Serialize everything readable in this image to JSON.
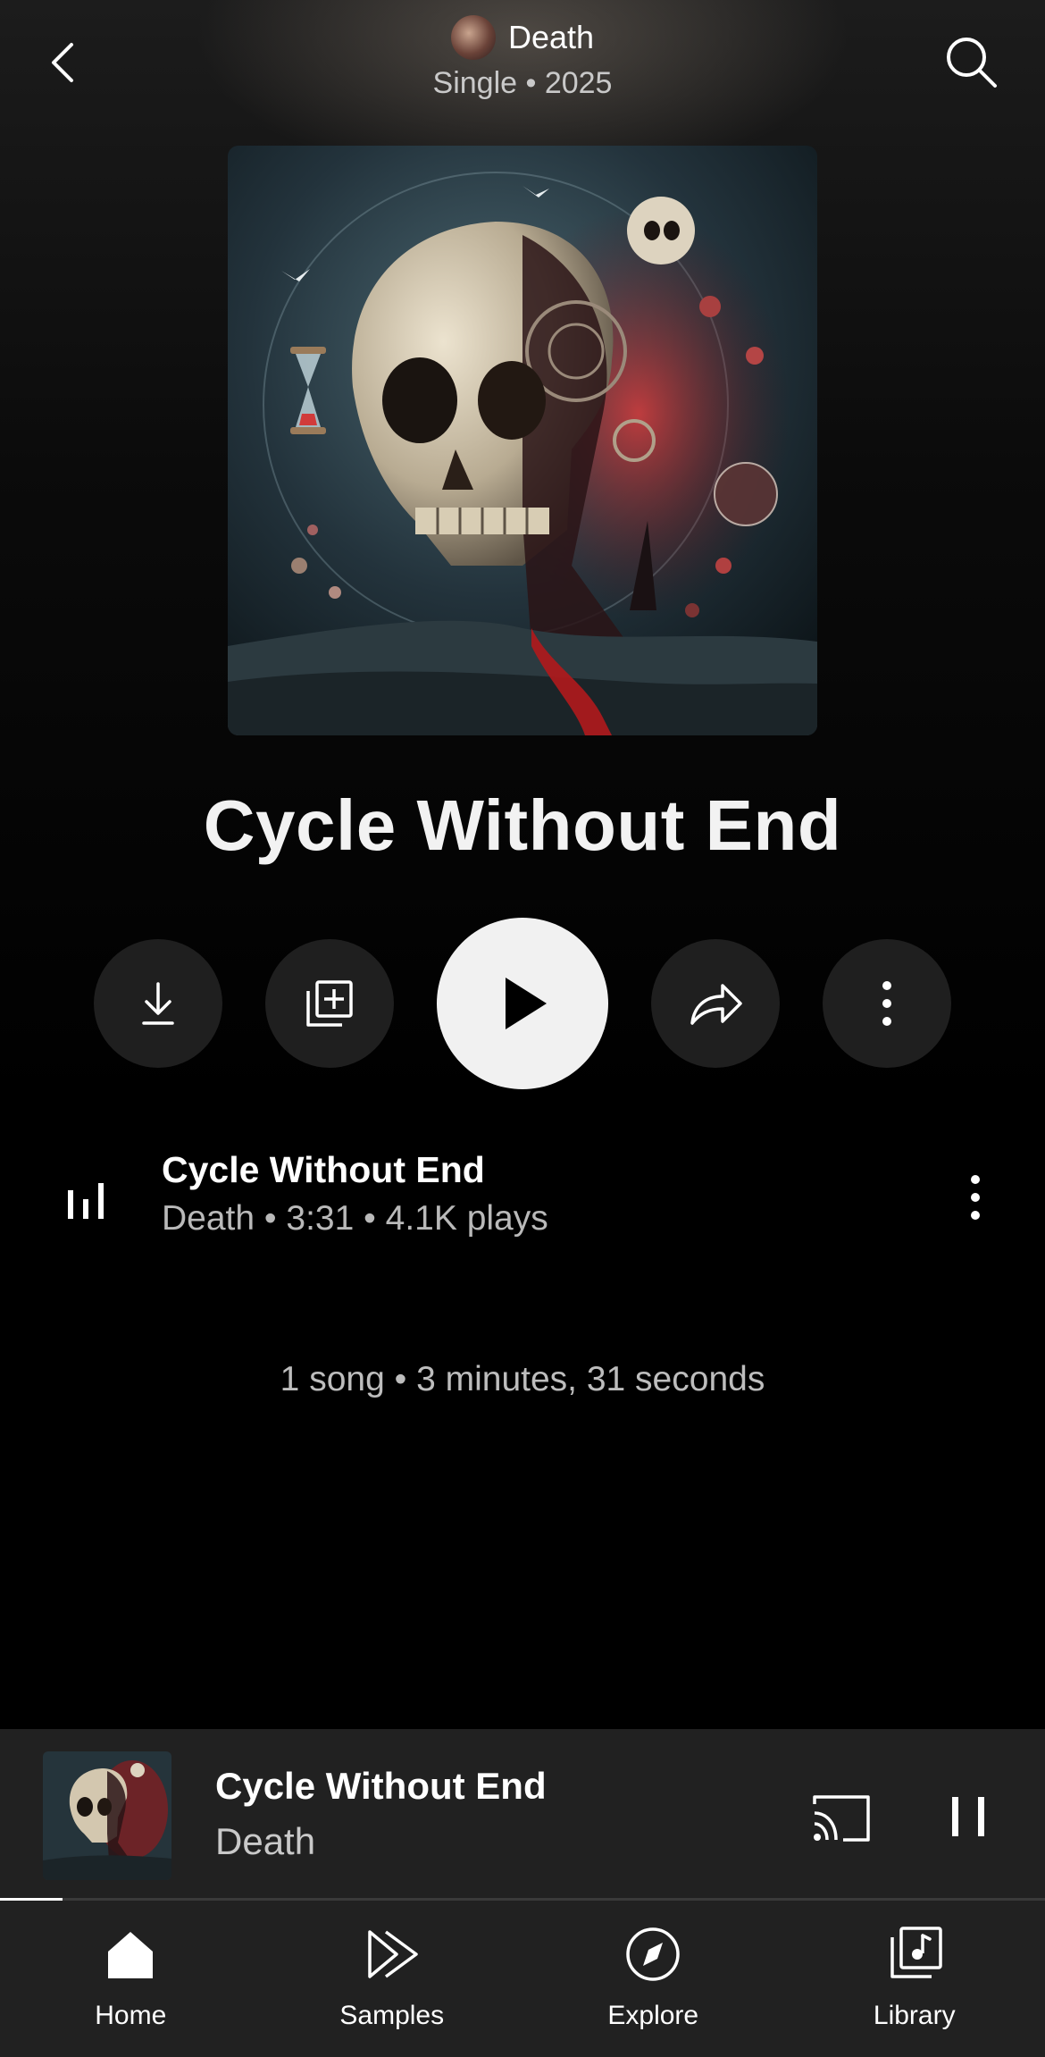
{
  "header": {
    "artist": "Death",
    "subtitle": "Single • 2025",
    "back_icon": "chevron-left-icon",
    "search_icon": "search-icon"
  },
  "album": {
    "title": "Cycle Without End"
  },
  "actions": {
    "download_icon": "download-icon",
    "add_icon": "add-to-library-icon",
    "play_icon": "play-icon",
    "share_icon": "share-icon",
    "more_icon": "more-vertical-icon"
  },
  "tracks": [
    {
      "title": "Cycle Without End",
      "meta": "Death • 3:31 • 4.1K plays",
      "playing_icon": "equalizer-icon"
    }
  ],
  "summary": "1 song • 3 minutes, 31 seconds",
  "mini_player": {
    "title": "Cycle Without End",
    "artist": "Death",
    "progress_fraction": 0.06,
    "cast_icon": "cast-icon",
    "pause_icon": "pause-icon"
  },
  "nav": {
    "items": [
      {
        "label": "Home",
        "icon": "home-icon",
        "active": true
      },
      {
        "label": "Samples",
        "icon": "samples-icon",
        "active": false
      },
      {
        "label": "Explore",
        "icon": "compass-icon",
        "active": false
      },
      {
        "label": "Library",
        "icon": "library-icon",
        "active": false
      }
    ]
  },
  "colors": {
    "background": "#000000",
    "surface": "#212121",
    "button_bg": "#1f1f1f",
    "play_bg": "#f1f1f1",
    "muted_text": "#b9b9b9"
  }
}
